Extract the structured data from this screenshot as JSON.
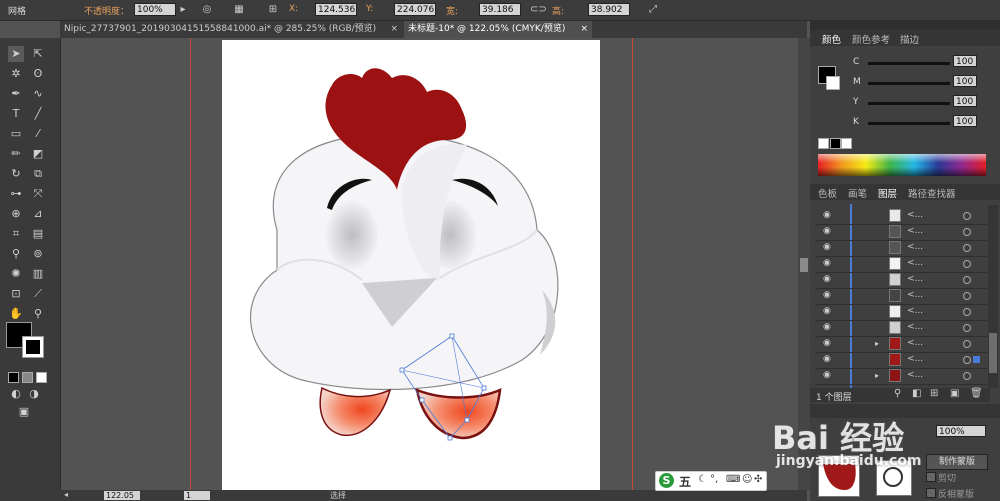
{
  "control_bar": {
    "workspace_label": "网格",
    "opacity_label": "不透明度：",
    "opacity_value": "100%",
    "x_label": "X:",
    "x_value": "124.536",
    "y_label": "Y:",
    "y_value": "224.076",
    "w_label": "宽:",
    "w_value": "39.186",
    "h_label": "高:",
    "h_value": "38.902"
  },
  "tabs": [
    {
      "label": "Nipic_27737901_20190304151558841000.ai* @ 285.25% (RGB/预览)"
    },
    {
      "label": "未标题-10* @ 122.05% (CMYK/预览)"
    }
  ],
  "status_bar": {
    "zoom": "122.05",
    "page": "1",
    "tool_name": "选择"
  },
  "color_panel": {
    "tabs": [
      "颜色",
      "颜色参考",
      "描边"
    ],
    "channels": [
      {
        "name": "C",
        "value": "100"
      },
      {
        "name": "M",
        "value": "100"
      },
      {
        "name": "Y",
        "value": "100"
      },
      {
        "name": "K",
        "value": "100"
      }
    ]
  },
  "layers_panel": {
    "tabs": [
      "色板",
      "画笔",
      "图层",
      "路径查找器"
    ],
    "rows": [
      {
        "name": "<...",
        "thumb": "#e8e8e8"
      },
      {
        "name": "<...",
        "thumb": "#555555"
      },
      {
        "name": "<...",
        "thumb": "#555555"
      },
      {
        "name": "<...",
        "thumb": "#f2f2f2"
      },
      {
        "name": "<...",
        "thumb": "#d0d0d0"
      },
      {
        "name": "<...",
        "thumb": "#444444"
      },
      {
        "name": "<...",
        "thumb": "#f0f0f0"
      },
      {
        "name": "<...",
        "thumb": "#cfcfcf"
      },
      {
        "name": "<...",
        "thumb": "#a01818"
      },
      {
        "name": "<...",
        "thumb": "#a01818"
      },
      {
        "name": "<...",
        "thumb": "#8b1515"
      },
      {
        "name": "<...",
        "thumb": "#8b1515"
      }
    ],
    "footer": "1 个图层"
  },
  "transparency_panel": {
    "opacity_value": "100%",
    "make_mask_label": "制作蒙版",
    "clip_label": "剪切",
    "invert_label": "反相蒙版"
  },
  "ime": {
    "label": "五"
  },
  "watermark": {
    "logo": "Bai 经验",
    "url": "jingyan.baidu.com"
  },
  "colors": {
    "comb": "#9c1111",
    "cheek": "#e8442a",
    "guide": "#c8463c"
  }
}
